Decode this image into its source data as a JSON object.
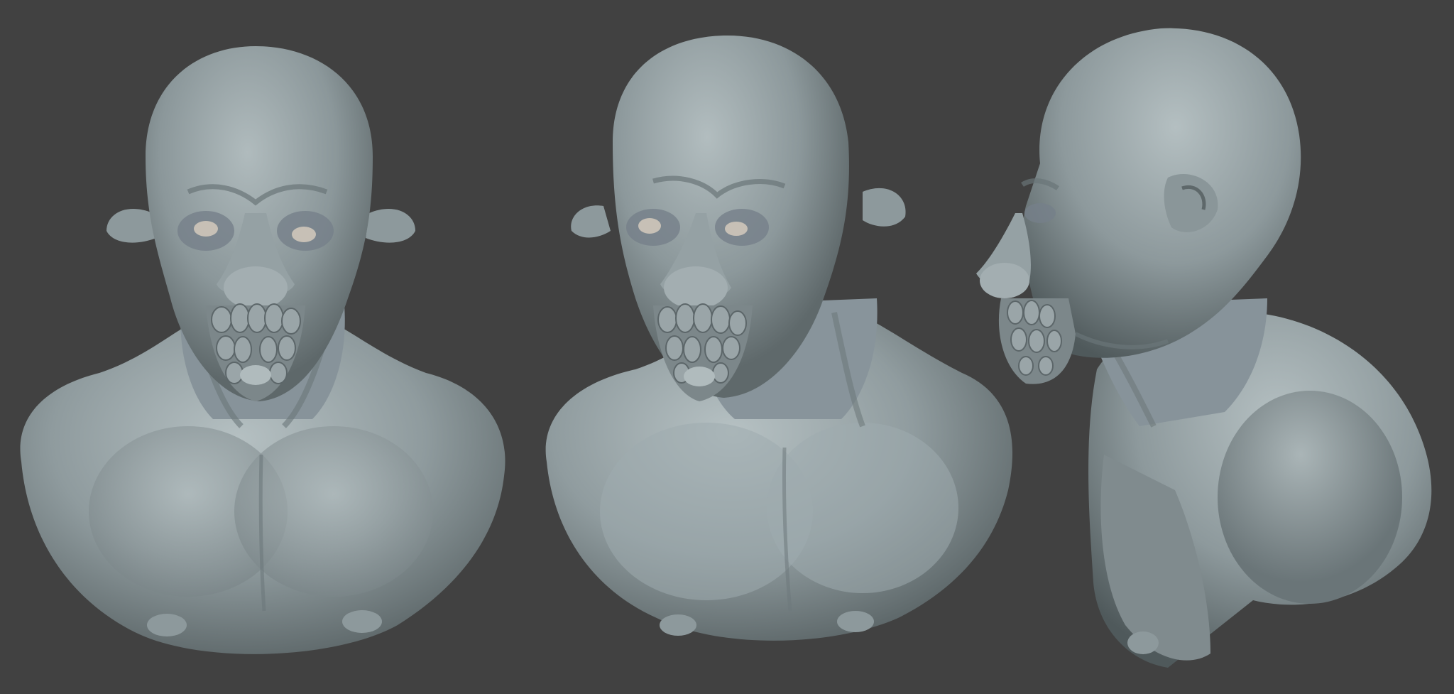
{
  "scene": {
    "background_color": "#414141",
    "material_color": "#8e9a9d",
    "highlight_color": "#b4bfc1",
    "shadow_color": "#4e5759",
    "eye_color": "#c7c0b6"
  },
  "views": [
    {
      "view": "front"
    },
    {
      "view": "three-quarter"
    },
    {
      "view": "side-profile"
    }
  ]
}
